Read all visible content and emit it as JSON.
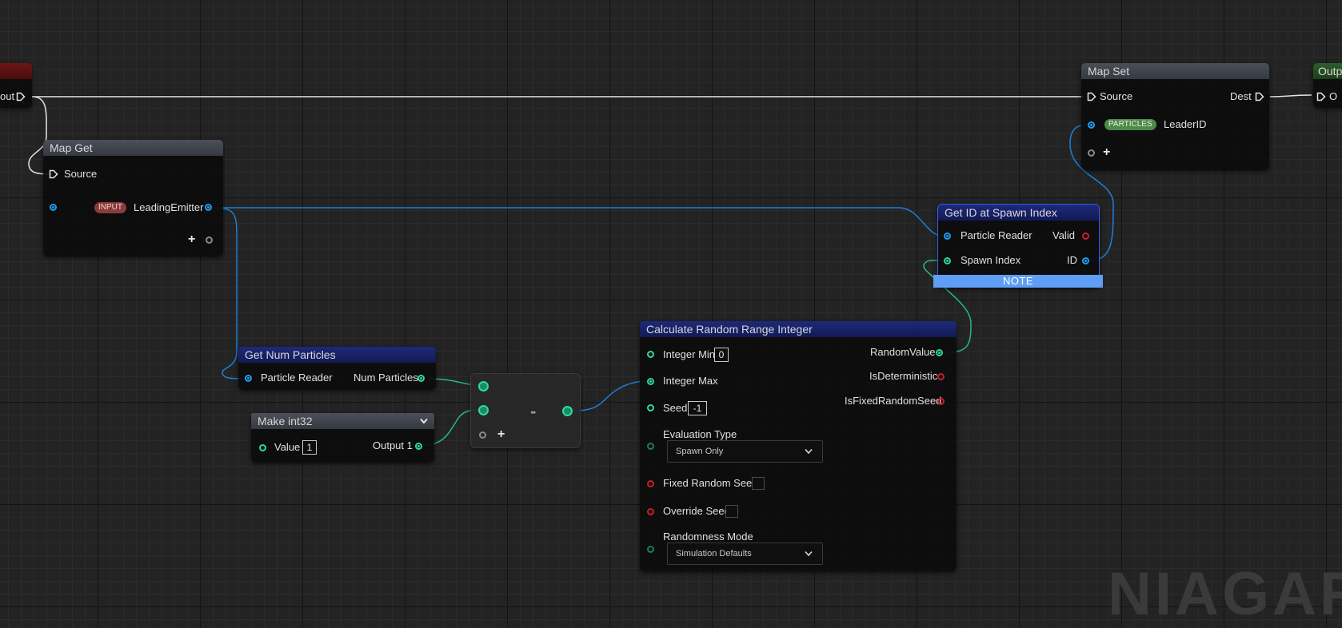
{
  "colors": {
    "float_teal": "#2fd9a0",
    "particle_reader_blue": "#1e9cf0",
    "bool_red": "#c81f2a",
    "wildcard_gray": "#8a8a8a",
    "note_blue": "#5e9ef5"
  },
  "left_cut_node": {
    "out_label": "out"
  },
  "right_cut_node": {
    "title": "Outp",
    "out_label": "O"
  },
  "map_get": {
    "title": "Map Get",
    "source_label": "Source",
    "namespace_badge": "INPUT",
    "param_label": "LeadingEmitter",
    "add_icon": "plus-icon"
  },
  "map_set": {
    "title": "Map Set",
    "source_label": "Source",
    "dest_label": "Dest",
    "namespace_badge": "PARTICLES",
    "param_label": "LeaderID",
    "add_icon": "plus-icon"
  },
  "get_id": {
    "title": "Get ID at Spawn Index",
    "in_particle_reader": "Particle Reader",
    "in_spawn_index": "Spawn Index",
    "out_valid": "Valid",
    "out_id": "ID",
    "note_label": "NOTE"
  },
  "num_particles": {
    "title": "Get Num Particles",
    "in_particle_reader": "Particle Reader",
    "out_num_particles": "Num Particles"
  },
  "make_int": {
    "title": "Make int32",
    "value_label": "Value",
    "value": "1",
    "output_label": "Output 1",
    "collapse_icon": "chevron-down-icon"
  },
  "subtract": {
    "operator": "-",
    "add_icon": "plus-icon"
  },
  "random_range": {
    "title": "Calculate Random Range Integer",
    "integer_min_label": "Integer Min",
    "integer_min_value": "0",
    "integer_max_label": "Integer Max",
    "seed_label": "Seed",
    "seed_value": "-1",
    "evaluation_type_label": "Evaluation Type",
    "evaluation_type_value": "Spawn Only",
    "fixed_random_seed_label": "Fixed Random Seed",
    "override_seed_label": "Override Seed",
    "randomness_mode_label": "Randomness Mode",
    "randomness_mode_value": "Simulation Defaults",
    "out_random_value": "RandomValue",
    "out_is_deterministic": "IsDeterministic",
    "out_is_fixed_random_seed": "IsFixedRandomSeed"
  },
  "watermark": "NIAGAR"
}
